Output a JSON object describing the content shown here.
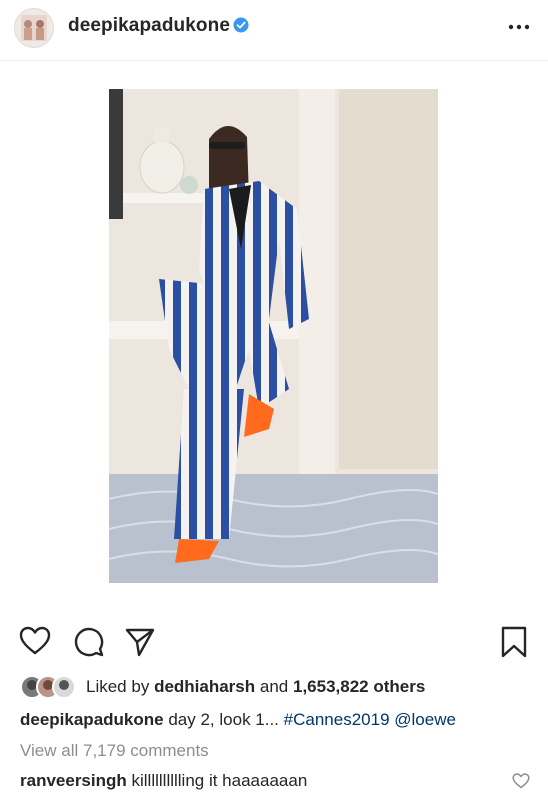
{
  "post": {
    "username": "deepikapadukone",
    "verified": true
  },
  "likes": {
    "prefix": "Liked by",
    "user": "dedhiaharsh",
    "and": "and",
    "count": "1,653,822 others"
  },
  "caption": {
    "username": "deepikapadukone",
    "text": "day 2, look 1...",
    "hashtag": "#Cannes2019",
    "mention": "@loewe"
  },
  "comments": {
    "view_all": "View all 7,179 comments",
    "first": {
      "username": "ranveersingh",
      "text": "killlllllllling it haaaaaaan"
    }
  },
  "icons": [
    "heart-icon",
    "comment-icon",
    "share-icon",
    "bookmark-icon",
    "more-icon",
    "verified-icon"
  ],
  "colors": {
    "verified": "#3897f0",
    "link": "#00376b",
    "muted": "#8e8e8e"
  }
}
